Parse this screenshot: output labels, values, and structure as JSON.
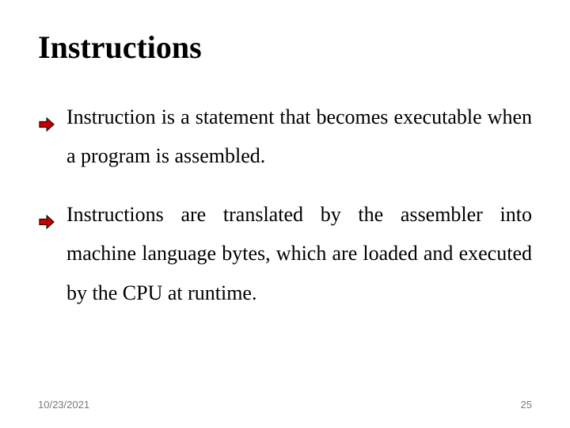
{
  "title": "Instructions",
  "bullets": [
    "Instruction is a statement that becomes executable when a program is assembled.",
    "Instructions are translated by the assembler into machine language bytes, which are loaded and executed by the CPU at runtime."
  ],
  "footer": {
    "date": "10/23/2021",
    "page": "25"
  },
  "colors": {
    "arrow_fill": "#c00000",
    "arrow_stroke": "#000000"
  }
}
